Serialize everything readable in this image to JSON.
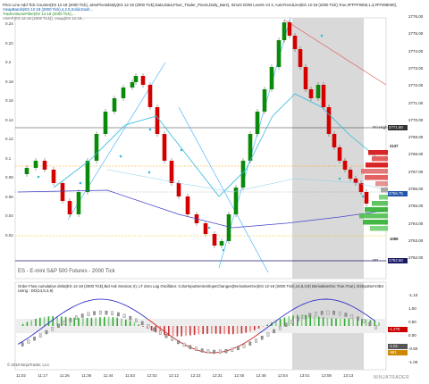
{
  "header": {
    "line1": "Price Line Add Tick Counter(ES 12-18 (2000 Tick), aimsPivotsDaily(ES 12-18 (2000 Tick),Data,Data,Floor_Trader_Pivots,Daily_Bars), Sim22 DOM Levels V4 3, AutoTrendLine(ES 12-18 (2000 Tick),True,#FFFF0000,1,3,#FF008000),",
    "line2": "VwapBands(ES 12-18 (2000 Tick),4,2.5,Solid,Dash...",
    "line3": "TradeVolumeFilter(ES 12-18 (2000 Tick),...",
    "line4": "VWAP(ES 12-18 (2000 Tick)), Vwap(ES 12-18..."
  },
  "price_labels_left": [
    "0.24",
    "0.22",
    "0.2",
    "0.18",
    "0.16",
    "0.14",
    "0.12",
    "0.1",
    "0.08",
    "0.06",
    "0.04",
    "0.02"
  ],
  "price_axis": [
    "2776.00",
    "2775.00",
    "2774.00",
    "2773.00",
    "2772.00",
    "2771.00",
    "2770.00",
    "2769.00",
    "2768.00",
    "2767.00",
    "2766.00",
    "2765.00",
    "2764.00",
    "2763.00",
    "2762.00"
  ],
  "price_tags": {
    "pri_high": "2771.50",
    "current": "2766.75",
    "s1": "2766.00",
    "pp": "2762.50",
    "low": "2765.25"
  },
  "levels": {
    "pri_high": "Pri-High",
    "pp": "PP"
  },
  "dom": {
    "top_count": "2137",
    "bottom_count": "1059"
  },
  "instrument_title": "ES - E-mini S&P 500 Futures - 2000 Tick",
  "time_axis": [
    "11:02",
    "11:17",
    "11:26",
    "11:36",
    "11:44",
    "11:53",
    "12:02",
    "12:12",
    "12:22",
    "12:31",
    "12:40",
    "12:48",
    "12:54",
    "13:01",
    "13:08",
    "13:13"
  ],
  "osc": {
    "header1": "Order Flow cumulative delta(ES 12-18 (2000 Tick),Bid Ask Session,X), LT Zero Lag Oscillator. ColorInputSeriesSlopeChanges(DerivativeOsc(ES 12-18 (2000 Tick),14,5,3,9) DerivativeOsc True,True), D3SpotterV3B4",
    "header2": "Using : DO(14,5,3,9)",
    "copyright": "© 2018 NinjaTrader, LLC",
    "axis": [
      "-1.10",
      "1.00",
      "0.50",
      "0.00",
      "-0.50",
      "-1.00"
    ],
    "tags": {
      "a": "-1.275",
      "b": "-1.01",
      "c": "-981"
    }
  },
  "watermark": "NINJATRADER",
  "colors": {
    "up": "#0a8a0a",
    "down": "#d40000",
    "bg_highlight": "#d9d9d9",
    "vwap": "#4444cc",
    "cyan": "#33bbdd",
    "pivot_orange": "#ff9900"
  }
}
